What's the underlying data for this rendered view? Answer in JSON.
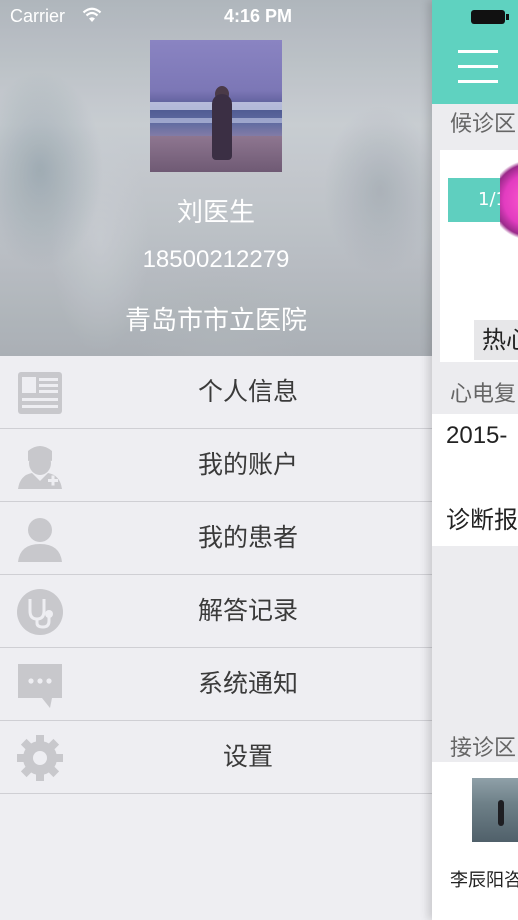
{
  "status_bar": {
    "carrier": "Carrier",
    "time": "4:16 PM"
  },
  "profile": {
    "name": "刘医生",
    "phone": "18500212279",
    "hospital": "青岛市市立医院"
  },
  "menu": {
    "items": [
      {
        "label": "个人信息",
        "icon": "id-card-icon"
      },
      {
        "label": "我的账户",
        "icon": "doctor-icon"
      },
      {
        "label": "我的患者",
        "icon": "patient-icon"
      },
      {
        "label": "解答记录",
        "icon": "stethoscope-icon"
      },
      {
        "label": "系统通知",
        "icon": "chat-bubble-icon"
      },
      {
        "label": "设置",
        "icon": "gear-icon"
      }
    ]
  },
  "main_preview": {
    "section_waiting": "候诊区",
    "banner_counter": "1/1",
    "hot_tag": "热心",
    "section_ecg": "心电复",
    "ecg_date": "2015-",
    "ecg_diagnosis": "诊断报",
    "section_reception": "接诊区",
    "consult_name": "李辰阳咨"
  },
  "colors": {
    "accent": "#5fd2c0",
    "menu_text": "#3a3a3a",
    "icon_gray": "#c8c8cc"
  }
}
